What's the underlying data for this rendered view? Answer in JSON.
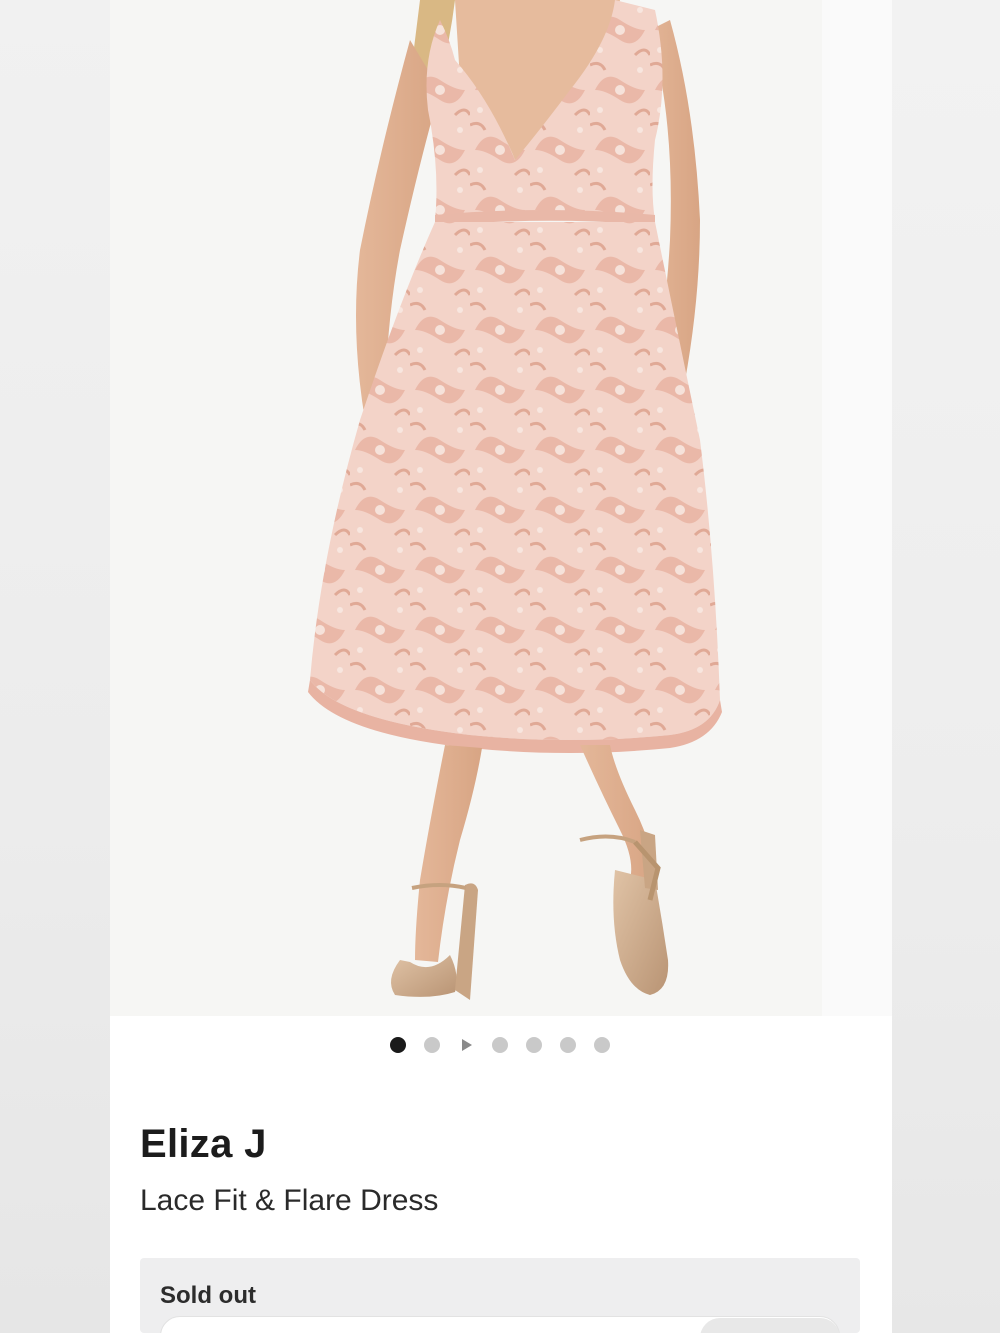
{
  "gallery": {
    "image_alt": "Model wearing a blush pink lace fit and flare midi dress with rose gold strappy sandals",
    "dots": [
      {
        "type": "dot",
        "active": true
      },
      {
        "type": "dot",
        "active": false
      },
      {
        "type": "video",
        "active": false
      },
      {
        "type": "dot",
        "active": false
      },
      {
        "type": "dot",
        "active": false
      },
      {
        "type": "dot",
        "active": false
      },
      {
        "type": "dot",
        "active": false
      }
    ]
  },
  "product": {
    "brand": "Eliza J",
    "name": "Lace Fit & Flare Dress"
  },
  "availability": {
    "status": "Sold out"
  },
  "colors": {
    "dress": "#f1c9bd",
    "background": "#f6f6f4",
    "active_dot": "#1a1a1a",
    "inactive_dot": "#c9c9c9"
  }
}
